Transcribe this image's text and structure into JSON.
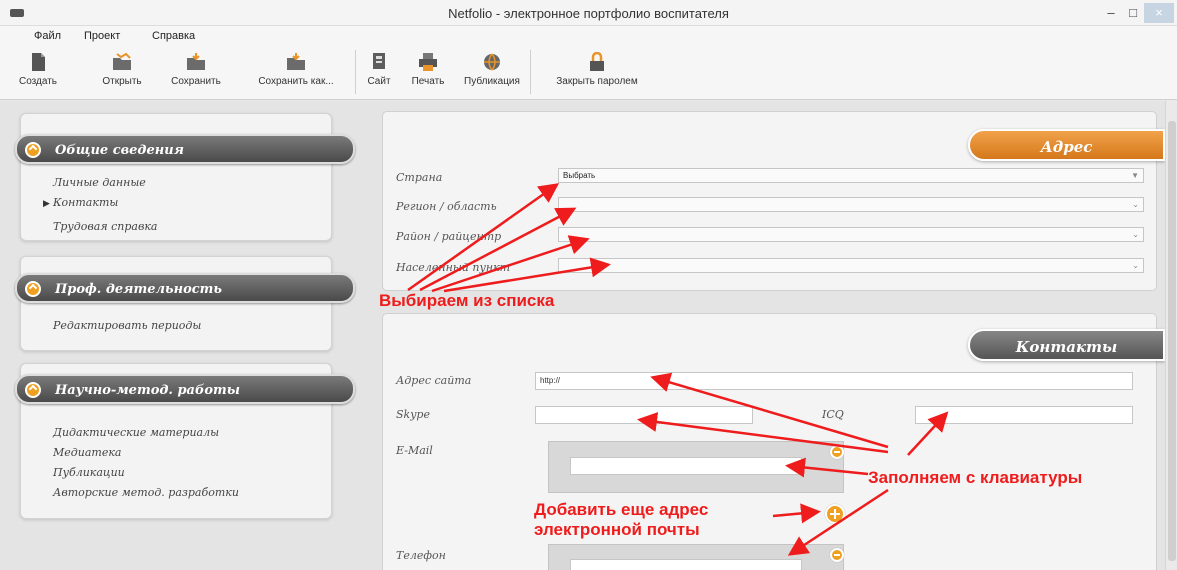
{
  "window": {
    "title": "Netfolio - электронное портфолио воспитателя",
    "minimize": "–",
    "maximize": "□",
    "close": "×"
  },
  "menu": [
    "Файл",
    "Проект",
    "Справка"
  ],
  "toolbar": {
    "create": "Создать",
    "open": "Открыть",
    "save": "Сохранить",
    "save_as": "Сохранить как...",
    "site": "Сайт",
    "print": "Печать",
    "publish": "Публикация",
    "lock": "Закрыть паролем"
  },
  "sidebar": {
    "general": {
      "title": "Общие сведения",
      "items": [
        "Личные данные",
        "Контакты",
        "Трудовая справка"
      ]
    },
    "prof": {
      "title": "Проф. деятельность",
      "items": [
        "Редактировать периоды"
      ]
    },
    "science": {
      "title": "Научно-метод. работы",
      "items": [
        "Дидактические материалы",
        "Медиатека",
        "Публикации",
        "Авторские метод. разработки"
      ]
    }
  },
  "address": {
    "title": "Адрес",
    "country_label": "Страна",
    "country_value": "Выбрать",
    "region_label": "Регион / область",
    "district_label": "Район / райцентр",
    "settlement_label": "Населенный пункт"
  },
  "contacts": {
    "title": "Контакты",
    "site_label": "Адрес сайта",
    "site_value": "http://",
    "skype_label": "Skype",
    "icq_label": "ICQ",
    "email_label": "E-Mail",
    "phone_label": "Телефон"
  },
  "annotations": {
    "choose": "Выбираем из списка",
    "keyboard": "Заполняем с клавиатуры",
    "add_email_line1": "Добавить еще адрес",
    "add_email_line2": "электронной почты"
  },
  "colors": {
    "accent": "#d5781b",
    "arrow": "#ee1c1c",
    "section_gray": "#555555"
  }
}
